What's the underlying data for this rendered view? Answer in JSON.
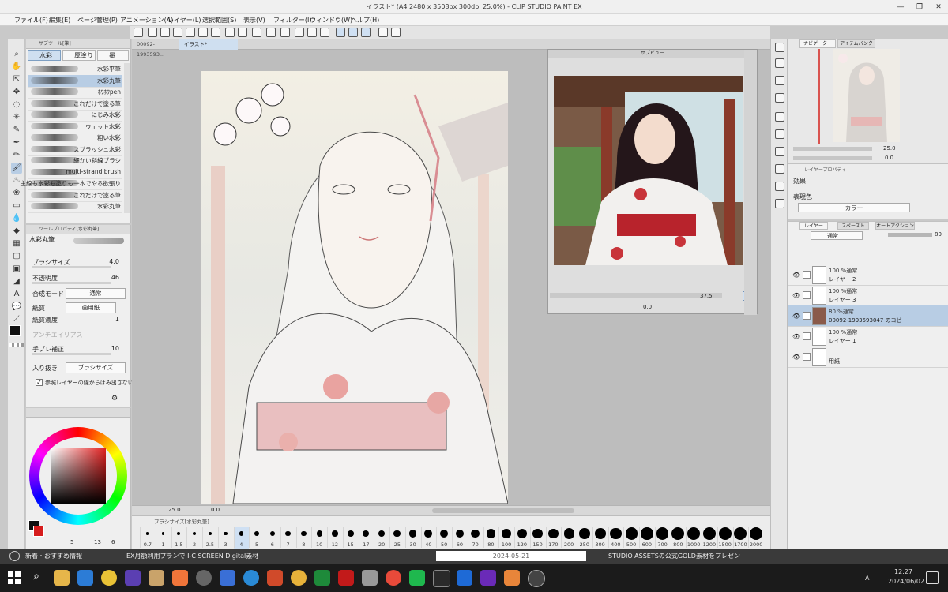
{
  "window": {
    "title": "イラスト* (A4 2480 x 3508px 300dpi 25.0%) - CLIP STUDIO PAINT EX",
    "controls": [
      "—",
      "❐",
      "✕"
    ]
  },
  "menu": [
    "ファイル(F)",
    "編集(E)",
    "ページ管理(P)",
    "アニメーション(A)",
    "レイヤー(L)",
    "選択範囲(S)",
    "表示(V)",
    "フィルター(I)",
    "ウィンドウ(W)",
    "ヘルプ(H)"
  ],
  "subtool": {
    "header": "サブツール[筆]",
    "tabs": [
      "水彩",
      "厚塗り",
      "墨"
    ],
    "brushes": [
      "水彩平筆",
      "水彩丸筆",
      "ﾎﾜﾎﾜpen",
      "これだけで塗る筆",
      "にじみ水彩",
      "ウェット水彩",
      "粗い水彩",
      "スプラッシュ水彩",
      "細かい斜線ブラシ",
      "multi-strand brush",
      "主線も水彩も塗りも一本でやる欲張り",
      "これだけで塗る筆",
      "水彩丸筆"
    ],
    "selected_index": 1
  },
  "tool_property": {
    "header": "ツールプロパティ[水彩丸筆]",
    "tool_name": "水彩丸筆",
    "brush_size_label": "ブラシサイズ",
    "brush_size_value": "4.0",
    "opacity_label": "不透明度",
    "opacity_value": "46",
    "blend_label": "合成モード",
    "blend_value": "通常",
    "paper_label": "紙質",
    "paper_value": "画用紙",
    "paper_density_label": "紙質濃度",
    "paper_density_value": "1",
    "antialias_label": "アンチエイリアス",
    "stabilization_label": "手ブレ補正",
    "stabilization_value": "10",
    "taper_label": "入り抜き",
    "taper_value": "ブラシサイズ",
    "ref_layer_label": "参照レイヤーの線からはみ出さない",
    "ref_layer_checked": true
  },
  "color": {
    "main": "#111111",
    "sub": "#d61c1c",
    "footer": [
      "5",
      "13",
      "6"
    ]
  },
  "canvas": {
    "tabs": [
      "00092-1993593...",
      "イラスト*"
    ],
    "zoom_value": "25.0",
    "angle_value": "0.0"
  },
  "brush_size_bar": {
    "header": "ブラシサイズ[水彩丸筆]",
    "sizes": [
      "0.7",
      "1",
      "1.5",
      "2",
      "2.5",
      "3",
      "4",
      "5",
      "6",
      "7",
      "8",
      "10",
      "12",
      "15",
      "17",
      "20",
      "25",
      "30",
      "40",
      "50",
      "60",
      "70",
      "80",
      "100",
      "120",
      "150",
      "170",
      "200",
      "250",
      "300",
      "400",
      "500",
      "600",
      "700",
      "800",
      "1000",
      "1200",
      "1500",
      "1700",
      "2000"
    ],
    "selected": "4"
  },
  "subview": {
    "title": "サブビュー",
    "zoom_value": "37.5",
    "angle_value": "0.0"
  },
  "navigator": {
    "tabs": [
      "ナビゲーター",
      "アイテムバンク"
    ],
    "zoom_value": "25.0",
    "angle_value": "0.0"
  },
  "layer_property": {
    "header": "レイヤープロパティ",
    "effect_label": "効果",
    "expression_label": "表現色",
    "expression_value": "カラー"
  },
  "layers": {
    "tabs": [
      "レイヤー",
      "スペースト",
      "オートアクション"
    ],
    "blend_mode": "通常",
    "opacity": "80",
    "rows": [
      {
        "meta": "100 %通常",
        "name": "レイヤー 2",
        "selected": false
      },
      {
        "meta": "100 %通常",
        "name": "レイヤー 3",
        "selected": false
      },
      {
        "meta": "80 %通常",
        "name": "00092-1993593047 のコピー",
        "selected": true
      },
      {
        "meta": "100 %通常",
        "name": "レイヤー 1",
        "selected": false
      },
      {
        "meta": "",
        "name": "用紙",
        "selected": false
      }
    ]
  },
  "bottom_strip": {
    "news_label": "新着・おすすめ情報",
    "promo_left": "EX月額利用プランで I-C SCREEN Digital素材",
    "date_label": "2024-05-21",
    "promo_right": "STUDIO ASSETSの公式GOLD素材をプレゼン"
  },
  "taskbar": {
    "time": "12:27",
    "date": "2024/06/02",
    "ime": "A"
  }
}
